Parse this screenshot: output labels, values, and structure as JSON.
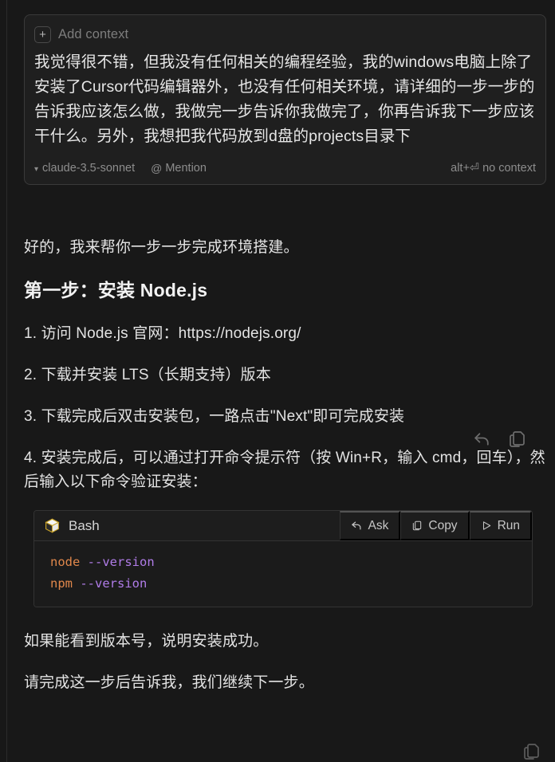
{
  "composer": {
    "add_context_label": "Add context",
    "add_context_icon": "plus-icon",
    "message": "我觉得很不错，但我没有任何相关的编程经验，我的windows电脑上除了安装了Cursor代码编辑器外，也没有任何相关环境，请详细的一步一步的告诉我应该怎么做，我做完一步告诉你我做完了，你再告诉我下一步应该干什么。另外，我想把我代码放到d盘的projects目录下",
    "model": "claude-3.5-sonnet",
    "model_chevron_icon": "chevron-down-icon",
    "mention_label": "Mention",
    "mention_icon": "at-icon",
    "shortcut_hint": "alt+⏎ no context"
  },
  "response": {
    "intro": "好的，我来帮你一步一步完成环境搭建。",
    "heading": "第一步：安装 Node.js",
    "steps": [
      "1. 访问 Node.js 官网：https://nodejs.org/",
      "2. 下载并安装 LTS（长期支持）版本",
      "3. 下载完成后双击安装包，一路点击\"Next\"即可完成安装",
      "4. 安装完成后，可以通过打开命令提示符（按 Win+R，输入 cmd，回车），然后输入以下命令验证安装："
    ],
    "closing": [
      "如果能看到版本号，说明安装成功。",
      "请完成这一步后告诉我，我们继续下一步。"
    ]
  },
  "codeblock": {
    "language": "Bash",
    "language_icon": "cube-icon",
    "actions": [
      {
        "label": "Ask",
        "icon": "reply-arrow-icon"
      },
      {
        "label": "Copy",
        "icon": "copy-icon"
      },
      {
        "label": "Run",
        "icon": "play-icon"
      }
    ],
    "lines": [
      {
        "cmd": "node",
        "flag": "--version"
      },
      {
        "cmd": "npm",
        "flag": "--version"
      }
    ]
  },
  "hover_actions": [
    {
      "icon": "undo-arrow-icon",
      "name": "revert-button"
    },
    {
      "icon": "copy-icon",
      "name": "copy-message-button"
    }
  ],
  "corner_action": {
    "icon": "copy-icon",
    "name": "copy-button"
  },
  "colors": {
    "background": "#181818",
    "composer_bg": "#1f1f1f",
    "code_bg": "#1b1b1b",
    "text": "#e3e3e3",
    "muted": "#8d8d8d",
    "code_cmd": "#e0874b",
    "code_flag": "#b07ce8"
  }
}
